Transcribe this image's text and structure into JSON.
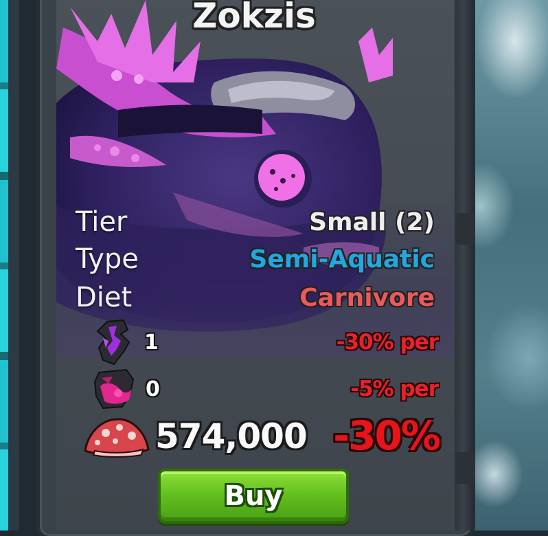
{
  "card": {
    "title": "Zokzis",
    "stats": [
      {
        "label": "Tier",
        "value": "Small (2)",
        "color": "#eeeeee"
      },
      {
        "label": "Type",
        "value": "Semi-Aquatic",
        "color": "#22a7e0"
      },
      {
        "label": "Diet",
        "value": "Carnivore",
        "color": "#ea5a5a"
      }
    ],
    "modifiers": [
      {
        "icon": "purple-mutation-icon",
        "count": "1",
        "penalty": "-30% per"
      },
      {
        "icon": "pink-mutation-icon",
        "count": "0",
        "penalty": "-5% per"
      }
    ],
    "price": {
      "icon": "mushroom-currency-icon",
      "amount": "574,000",
      "discount": "-30%"
    },
    "buy_label": "Buy"
  },
  "colors": {
    "accent_green": "#64c11e",
    "penalty_red": "#e8222a",
    "creature_purple": "#3b2a6b",
    "creature_pink": "#e36ee8"
  }
}
